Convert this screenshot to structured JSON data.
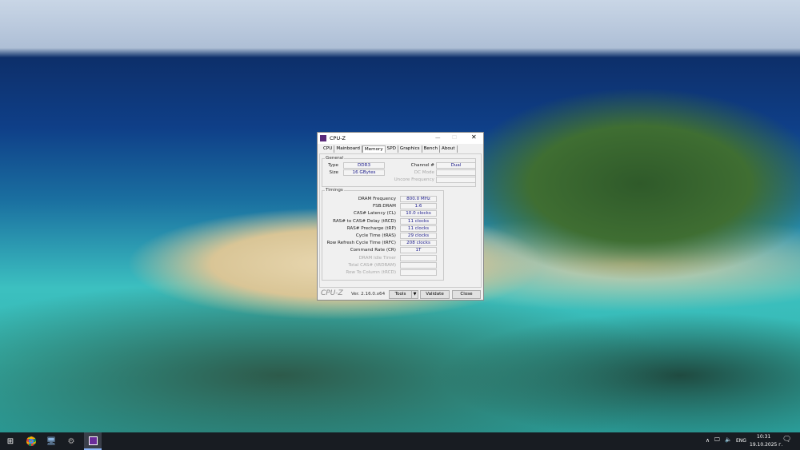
{
  "window": {
    "title": "CPU-Z",
    "tabs": [
      "CPU",
      "Mainboard",
      "Memory",
      "SPD",
      "Graphics",
      "Bench",
      "About"
    ],
    "active_tab": "Memory",
    "general": {
      "title": "General",
      "type_label": "Type",
      "type": "DDR3",
      "size_label": "Size",
      "size": "16 GBytes",
      "channel_label": "Channel #",
      "channel": "Dual",
      "dc_mode_label": "DC Mode",
      "dc_mode": "",
      "uncore_label": "Uncore Frequency",
      "uncore": ""
    },
    "timings": {
      "title": "Timings",
      "rows": [
        {
          "label": "DRAM Frequency",
          "value": "800.0 MHz",
          "enabled": true
        },
        {
          "label": "FSB:DRAM",
          "value": "1:6",
          "enabled": true
        },
        {
          "label": "CAS# Latency (CL)",
          "value": "10.0 clocks",
          "enabled": true
        },
        {
          "label": "RAS# to CAS# Delay (tRCD)",
          "value": "11 clocks",
          "enabled": true
        },
        {
          "label": "RAS# Precharge (tRP)",
          "value": "11 clocks",
          "enabled": true
        },
        {
          "label": "Cycle Time (tRAS)",
          "value": "29 clocks",
          "enabled": true
        },
        {
          "label": "Row Refresh Cycle Time (tRFC)",
          "value": "208 clocks",
          "enabled": true
        },
        {
          "label": "Command Rate (CR)",
          "value": "1T",
          "enabled": true
        },
        {
          "label": "DRAM Idle Timer",
          "value": "",
          "enabled": false
        },
        {
          "label": "Total CAS# (tRDRAM)",
          "value": "",
          "enabled": false
        },
        {
          "label": "Row To Column (tRCD)",
          "value": "",
          "enabled": false
        }
      ]
    },
    "footer": {
      "logo": "CPU-Z",
      "version": "Ver. 2.16.0.x64",
      "tools": "Tools",
      "validate": "Validate",
      "close": "Close"
    }
  },
  "taskbar": {
    "language": "ENG",
    "time": "10:31",
    "date": "19.10.2025 г."
  }
}
